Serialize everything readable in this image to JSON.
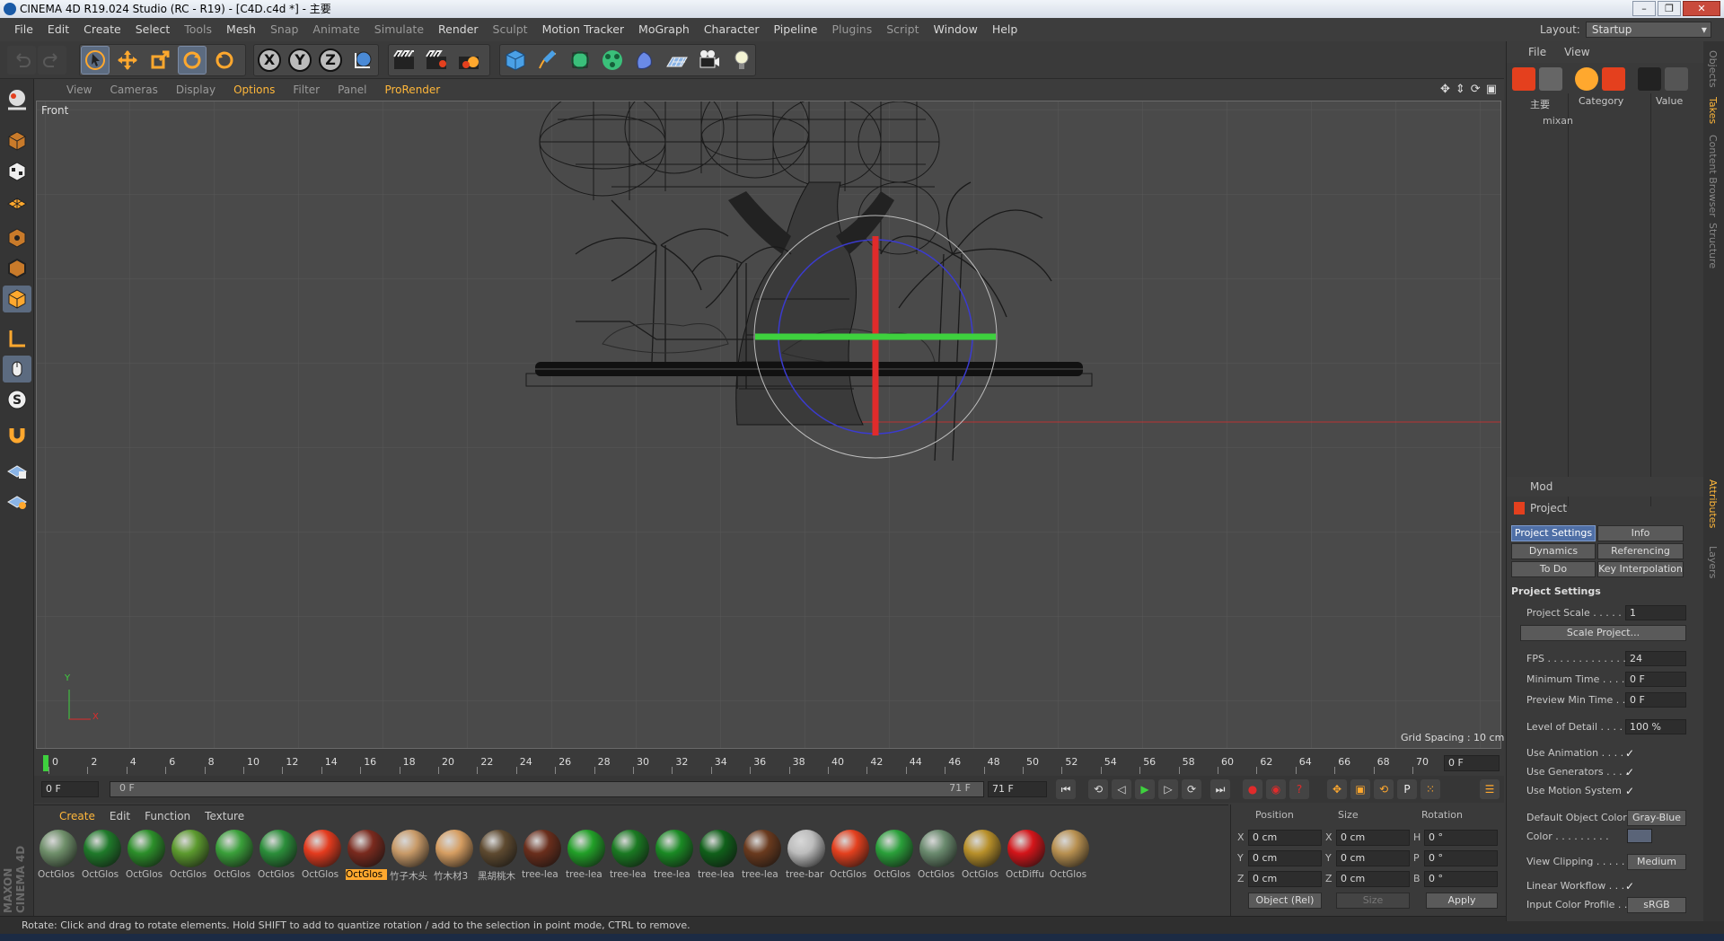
{
  "window": {
    "title": "CINEMA 4D R19.024 Studio (RC - R19) - [C4D.c4d *] - 主要",
    "buttons": [
      "–",
      "❐",
      "✕"
    ]
  },
  "menu": [
    "File",
    "Edit",
    "Create",
    "Select",
    "Tools",
    "Mesh",
    "Snap",
    "Animate",
    "Simulate",
    "Render",
    "Sculpt",
    "Motion Tracker",
    "MoGraph",
    "Character",
    "Pipeline",
    "Plugins",
    "Script",
    "Window",
    "Help"
  ],
  "layout": {
    "label": "Layout:",
    "value": "Startup"
  },
  "toolbar": {
    "x_axis": "X",
    "y_axis": "Y",
    "z_axis": "Z"
  },
  "viewport_menu": [
    "View",
    "Cameras",
    "Display",
    "Options",
    "Filter",
    "Panel",
    "ProRender"
  ],
  "viewport": {
    "name": "Front",
    "grid_spacing": "Grid Spacing : 10 cm",
    "axis_y": "Y",
    "axis_x": "X"
  },
  "timeline": {
    "ticks": [
      "0",
      "2",
      "4",
      "6",
      "8",
      "10",
      "12",
      "14",
      "16",
      "18",
      "20",
      "22",
      "24",
      "26",
      "28",
      "30",
      "32",
      "34",
      "36",
      "38",
      "40",
      "42",
      "44",
      "46",
      "48",
      "50",
      "52",
      "54",
      "56",
      "58",
      "60",
      "62",
      "64",
      "66",
      "68",
      "70"
    ],
    "current_frame": "0 F"
  },
  "timecontrol": {
    "start": "0 F",
    "range_start": "0 F",
    "range_end": "71 F",
    "end": "71 F"
  },
  "material_menu": [
    "Create",
    "Edit",
    "Function",
    "Texture"
  ],
  "materials": [
    {
      "label": "OctGlos",
      "color": "#6f8f6a"
    },
    {
      "label": "OctGlos",
      "color": "#1f7a2a"
    },
    {
      "label": "OctGlos",
      "color": "#2c8f2a"
    },
    {
      "label": "OctGlos",
      "color": "#5c9a2e"
    },
    {
      "label": "OctGlos",
      "color": "#3aa03a"
    },
    {
      "label": "OctGlos",
      "color": "#2b8e3a"
    },
    {
      "label": "OctGlos",
      "color": "#e43b1e"
    },
    {
      "label": "OctGlos",
      "color": "#7a2a1e",
      "selected": true
    },
    {
      "label": "竹子木头",
      "color": "#c89a68"
    },
    {
      "label": "竹木材3",
      "color": "#d69e62"
    },
    {
      "label": "黑胡桃木",
      "color": "#5e4a30"
    },
    {
      "label": "tree-lea",
      "color": "#6a2e1c"
    },
    {
      "label": "tree-lea",
      "color": "#22a028"
    },
    {
      "label": "tree-lea",
      "color": "#1a7a22"
    },
    {
      "label": "tree-lea",
      "color": "#1a8a24"
    },
    {
      "label": "tree-lea",
      "color": "#10601a"
    },
    {
      "label": "tree-lea",
      "color": "#6a3a1e"
    },
    {
      "label": "tree-bar",
      "color": "#bdbdbd"
    },
    {
      "label": "OctGlos",
      "color": "#e4401e"
    },
    {
      "label": "OctGlos",
      "color": "#2aa03a"
    },
    {
      "label": "OctGlos",
      "color": "#6a8a6e"
    },
    {
      "label": "OctGlos",
      "color": "#b8902a"
    },
    {
      "label": "OctDiffu",
      "color": "#d4151a"
    },
    {
      "label": "OctGlos",
      "color": "#b89050"
    }
  ],
  "coords": {
    "headers": [
      "Position",
      "Size",
      "Rotation"
    ],
    "rows": [
      {
        "axis": "X",
        "pos": "0 cm",
        "saxis": "X",
        "size": "0 cm",
        "raxis": "H",
        "rot": "0 °"
      },
      {
        "axis": "Y",
        "pos": "0 cm",
        "saxis": "Y",
        "size": "0 cm",
        "raxis": "P",
        "rot": "0 °"
      },
      {
        "axis": "Z",
        "pos": "0 cm",
        "saxis": "Z",
        "size": "0 cm",
        "raxis": "B",
        "rot": "0 °"
      }
    ],
    "mode": "Object (Rel)",
    "size_mode": "Size",
    "apply": "Apply"
  },
  "status": "Rotate: Click and drag to rotate elements. Hold SHIFT to add to quantize rotation / add to the selection in point mode, CTRL to remove.",
  "objects": {
    "menu": [
      "File",
      "View"
    ],
    "columns": [
      "Category",
      "Value"
    ],
    "root": "主要",
    "child": "mixan"
  },
  "attributes": {
    "mode": "Mod",
    "title": "Project",
    "tabs": [
      {
        "label": "Project Settings",
        "selected": true
      },
      {
        "label": "Info"
      },
      {
        "label": "Dynamics"
      },
      {
        "label": "Referencing"
      },
      {
        "label": "To Do"
      },
      {
        "label": "Key Interpolation"
      }
    ],
    "section": "Project Settings",
    "project_scale_label": "Project Scale . . . . . .",
    "project_scale": "1",
    "scale_project": "Scale Project...",
    "fps_label": "FPS . . . . . . . . . . . . .",
    "fps": "24",
    "min_time_label": "Minimum Time . . . . .",
    "min_time": "0 F",
    "preview_min_label": "Preview Min Time . . .",
    "preview_min": "0 F",
    "lod_label": "Level of Detail . . . . .",
    "lod": "100 %",
    "use_animation": "Use Animation . . . . .",
    "use_generators": "Use Generators . . . .",
    "use_motion": "Use Motion System",
    "checkmark": "✓",
    "default_color_label": "Default Object Color",
    "default_color": "Gray-Blue",
    "color_label": "Color . . . . . . . . .",
    "view_clipping_label": "View Clipping . . . . .",
    "view_clipping": "Medium",
    "linear_workflow": "Linear Workflow . . .",
    "input_profile_label": "Input Color Profile . .",
    "input_profile": "sRGB"
  },
  "side_tabs": [
    "Objects",
    "Takes",
    "Content Browser",
    "Structure",
    "Attributes",
    "Layers"
  ],
  "logo": "MAXON CINEMA 4D",
  "colors": {
    "accent": "#ffb73a",
    "selected_tab": "#4f6fa6",
    "x_axis": "#e02b2b",
    "y_axis": "#3ed13e",
    "rot_circle": "#3b3bcf"
  }
}
